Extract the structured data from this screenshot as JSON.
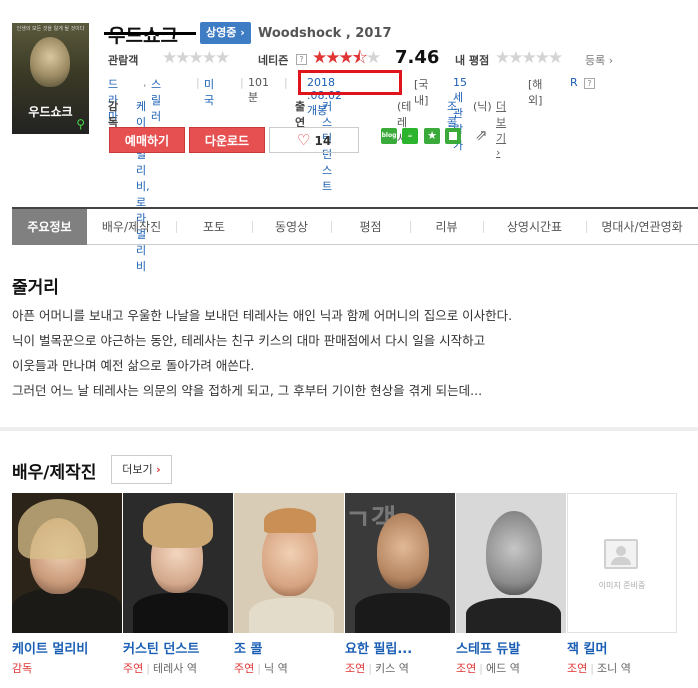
{
  "movie": {
    "poster_title": "우드쇼크",
    "poster_tagline": "인생의 모든 것을 잃게 될 것이다",
    "title": "우드쇼크",
    "status_badge": "상영중 ›",
    "original_title": "Woodshock , 2017"
  },
  "ratings": {
    "audience_label": "관람객",
    "netizen_label": "네티즌",
    "netizen_score": "7.46",
    "netizen_stars": 3.73,
    "my_rating_label": "내 평점",
    "register_label": "등록 ›"
  },
  "info": {
    "genres": [
      "드라마",
      "스릴러"
    ],
    "country": "미국",
    "runtime": "101분",
    "release": "2018 .08.02 개봉",
    "domestic_label": "[국내]",
    "domestic_rating": "15세 관람가",
    "foreign_label": "[해외]",
    "foreign_rating": "R",
    "director_label": "감독",
    "directors": "케이트 멀리비, 로라 멀리비",
    "cast_label": "출연",
    "cast_line": "커스틴 던스트",
    "cast_role_1": "(테레사),",
    "cast_line_2": "조 콜",
    "cast_role_2": "(닉)",
    "cast_more": "더보기 ›"
  },
  "actions": {
    "reserve": "예매하기",
    "download": "다운로드",
    "like_count": "14"
  },
  "share_icons": [
    "blog",
    "cafe",
    "star",
    "kakao"
  ],
  "tabs": [
    "주요정보",
    "배우/제작진",
    "포토",
    "동영상",
    "평점",
    "리뷰",
    "상영시간표",
    "명대사/연관영화"
  ],
  "synopsis": {
    "title": "줄거리",
    "lines": [
      "아픈 어머니를 보내고 우울한 나날을 보내던 테레사는 애인 닉과 함께 어머니의 집으로 이사한다.",
      " 닉이 벌목꾼으로 야근하는 동안, 테레사는 친구 키스의 대마 판매점에서 다시 일을 시작하고",
      " 이웃들과 만나며 예전 삶으로 돌아가려 애쓴다.",
      " 그러던 어느 날 테레사는 의문의 약을 접하게 되고, 그 후부터 기이한 현상을 겪게 되는데..."
    ]
  },
  "cast_section": {
    "title": "배우/제작진",
    "more_label": "더보기",
    "no_image_label": "이미지 준비중",
    "people": [
      {
        "name": "케이트 멀리비",
        "type": "감독",
        "role": ""
      },
      {
        "name": "커스틴 던스트",
        "type": "주연",
        "role": "테레사 역"
      },
      {
        "name": "조 콜",
        "type": "주연",
        "role": "닉 역"
      },
      {
        "name": "요한 필립...",
        "type": "조연",
        "role": "키스 역"
      },
      {
        "name": "스테프 듀발",
        "type": "조연",
        "role": "에드 역"
      },
      {
        "name": "잭 킬머",
        "type": "조연",
        "role": "조니 역"
      }
    ]
  },
  "colors": {
    "accent_red": "#e65050",
    "link_blue": "#1a5fb4",
    "badge_blue": "#3e7cc4",
    "highlight_box": "#e0141c"
  }
}
